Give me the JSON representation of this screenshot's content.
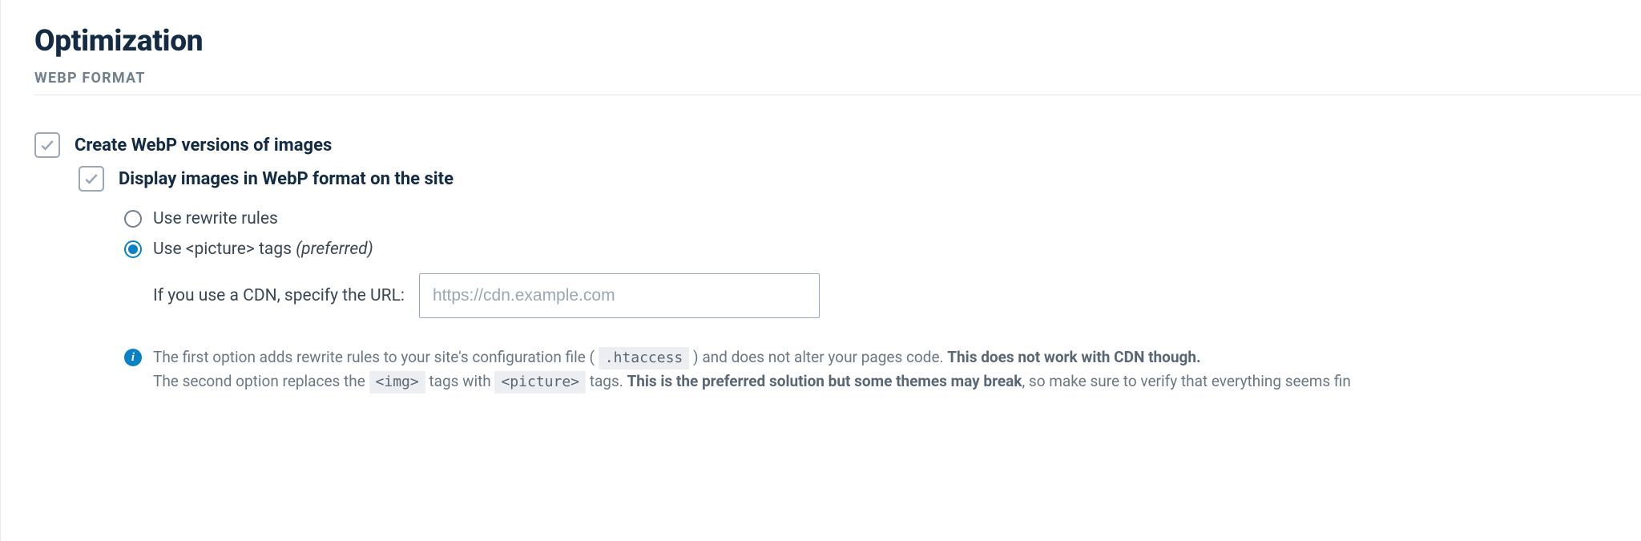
{
  "header": {
    "title": "Optimization",
    "subtitle": "WEBP FORMAT"
  },
  "options": {
    "create_webp": {
      "label": "Create WebP versions of images",
      "checked": true
    },
    "display_webp": {
      "label": "Display images in WebP format on the site",
      "checked": true
    }
  },
  "display_methods": {
    "rewrite": {
      "label": "Use rewrite rules",
      "selected": false
    },
    "picture": {
      "label_prefix": "Use <picture> tags ",
      "label_suffix_italic": "(preferred)",
      "selected": true
    }
  },
  "cdn": {
    "label": "If you use a CDN, specify the URL:",
    "placeholder": "https://cdn.example.com",
    "value": ""
  },
  "info": {
    "line1_a": "The first option adds rewrite rules to your site's configuration file ( ",
    "line1_code": ".htaccess",
    "line1_b": " ) and does not alter your pages code. ",
    "line1_strong": "This does not work with CDN though.",
    "line2_a": "The second option replaces the ",
    "line2_code1": "<img>",
    "line2_b": " tags with ",
    "line2_code2": "<picture>",
    "line2_c": " tags. ",
    "line2_strong": "This is the preferred solution but some themes may break",
    "line2_d": ", so make sure to verify that everything seems fin"
  }
}
